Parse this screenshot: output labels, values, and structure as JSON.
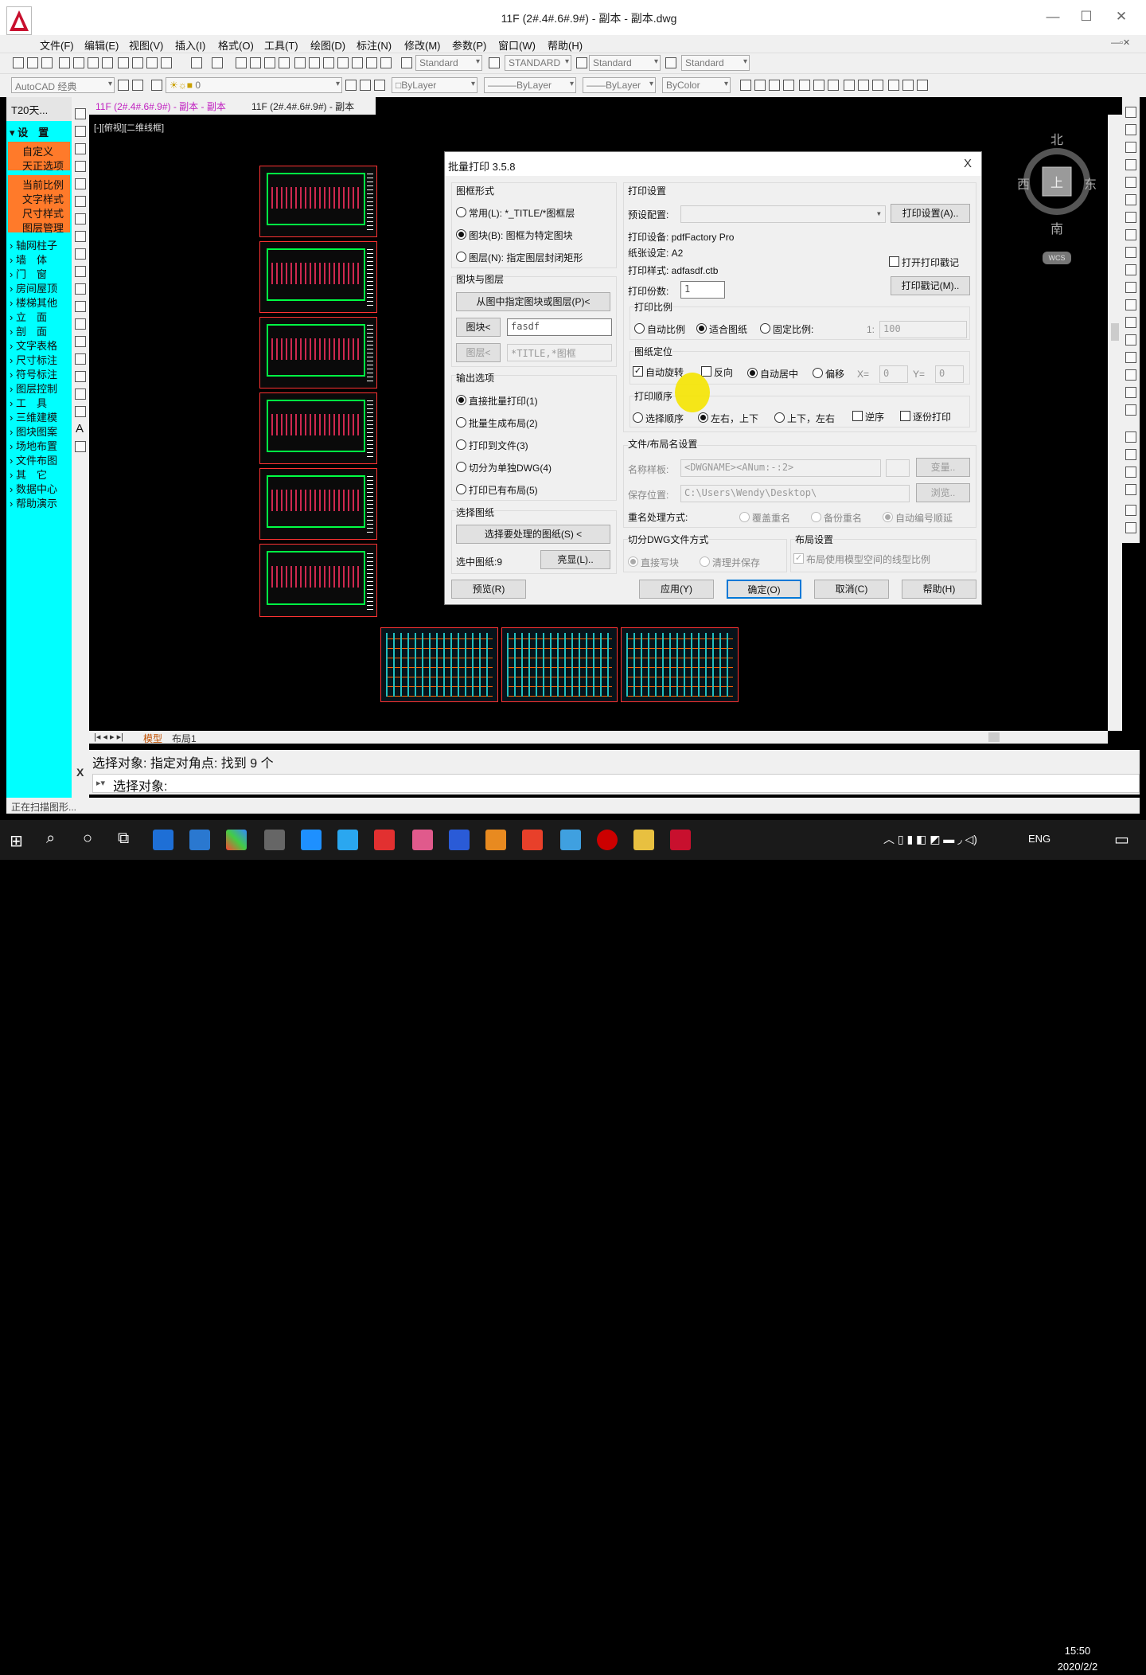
{
  "window": {
    "title": "11F (2#.4#.6#.9#) - 副本 - 副本.dwg",
    "min": "—",
    "max": "☐",
    "close": "✕"
  },
  "menu": [
    "文件(F)",
    "编辑(E)",
    "视图(V)",
    "插入(I)",
    "格式(O)",
    "工具(T)",
    "绘图(D)",
    "标注(N)",
    "修改(M)",
    "参数(P)",
    "窗口(W)",
    "帮助(H)"
  ],
  "toolbar": {
    "text_style": "Standard",
    "dim_style": "STANDARD",
    "table_style": "Standard",
    "mleader_style": "Standard",
    "workspace": "AutoCAD 经典",
    "layer": "0",
    "color": "ByLayer",
    "linetype": "ByLayer",
    "lineweight": "ByLayer",
    "plotstyle": "ByColor"
  },
  "left_panel": {
    "header": "T20天...",
    "settings": "设　置",
    "orange_items": [
      "自定义",
      "天正选项",
      "当前比例",
      "文字样式",
      "尺寸样式",
      "图层管理"
    ],
    "items": [
      "轴网柱子",
      "墙　体",
      "门　窗",
      "房间屋顶",
      "楼梯其他",
      "立　面",
      "剖　面",
      "文字表格",
      "尺寸标注",
      "符号标注",
      "图层控制",
      "工　具",
      "三维建模",
      "图块图案",
      "场地布置",
      "文件布图",
      "其　它",
      "数据中心",
      "帮助演示"
    ]
  },
  "doc_tabs": [
    "11F (2#.4#.6#.9#) - 副本 - 副本",
    "11F (2#.4#.6#.9#) - 副本"
  ],
  "viewport_label": "[-][俯视][二维线框]",
  "compass": {
    "north": "北",
    "south": "南",
    "east": "东",
    "west": "西",
    "top": "上",
    "wcs": "WCS"
  },
  "layout_tabs": [
    "模型",
    "布局1"
  ],
  "dialog": {
    "title": "批量打印 3.5.8",
    "close": "X",
    "frame_form": "图框形式",
    "frame_opts": [
      "常用(L): *_TITLE/*图框层",
      "图块(B): 图框为特定图块",
      "图层(N): 指定图层封闭矩形"
    ],
    "block_layer": "图块与图层",
    "pick_btn": "从图中指定图块或图层(P)<",
    "block_btn": "图块<",
    "block_val": "fasdf",
    "layer_btn": "图层<",
    "layer_val": "*TITLE,*图框",
    "output": "输出选项",
    "output_opts": [
      "直接批量打印(1)",
      "批量生成布局(2)",
      "打印到文件(3)",
      "切分为单独DWG(4)",
      "打印已有布局(5)"
    ],
    "select_sheets": "选择图纸",
    "select_btn": "选择要处理的图纸(S) <",
    "selected_count": "选中图纸:9",
    "highlight_btn": "亮显(L)..",
    "preview_btn": "预览(R)",
    "print_settings": "打印设置",
    "preset_label": "预设配置:",
    "print_setup_btn": "打印设置(A)..",
    "device": "打印设备: pdfFactory Pro",
    "paper": "纸张设定: A2",
    "style": "打印样式: adfasdf.ctb",
    "open_log": "打开打印戳记",
    "copies_label": "打印份数:",
    "copies": "1",
    "log_btn": "打印戳记(M)..",
    "scale": "打印比例",
    "scale_opts": [
      "自动比例",
      "适合图纸",
      "固定比例:"
    ],
    "scale_prefix": "1:",
    "scale_val": "100",
    "position": "图纸定位",
    "auto_rotate": "自动旋转",
    "reverse": "反向",
    "auto_center": "自动居中",
    "offset": "偏移",
    "x_label": "X=",
    "x_val": "0",
    "y_label": "Y=",
    "y_val": "0",
    "order": "打印顺序",
    "order_opts": [
      "选择顺序",
      "左右，上下",
      "上下，左右"
    ],
    "reverse_order": "逆序",
    "per_copy": "逐份打印",
    "file_layout": "文件/布局名设置",
    "name_label": "名称样板:",
    "name_val": "<DWGNAME><ANum:-:2>",
    "var_btn": "变量..",
    "save_label": "保存位置:",
    "save_val": "C:\\Users\\Wendy\\Desktop\\",
    "browse_btn": "浏览..",
    "dup_label": "重名处理方式:",
    "dup_opts": [
      "覆盖重名",
      "备份重名",
      "自动编号顺延"
    ],
    "split_mode": "切分DWG文件方式",
    "split_opts": [
      "直接写块",
      "清理并保存"
    ],
    "layout_set": "布局设置",
    "layout_chk": "布局使用模型空间的线型比例",
    "apply": "应用(Y)",
    "ok": "确定(O)",
    "cancel": "取消(C)",
    "help": "帮助(H)"
  },
  "command": {
    "history": "选择对象: 指定对角点: 找到 9 个",
    "prompt": "选择对象:",
    "x": "X"
  },
  "status": "正在扫描图形...",
  "taskbar": {
    "time": "15:50",
    "date": "2020/2/2",
    "lang": "ENG"
  }
}
